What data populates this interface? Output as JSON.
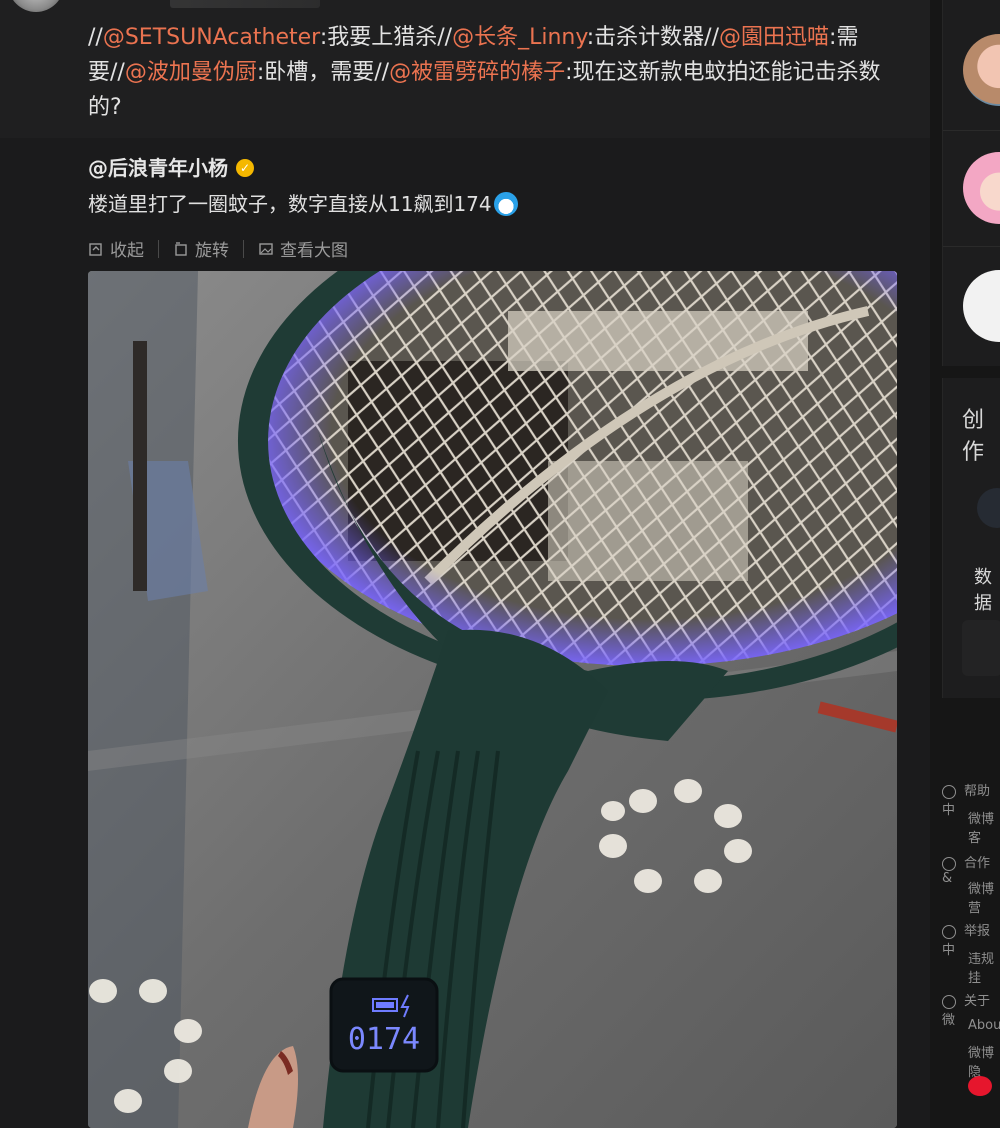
{
  "repost": {
    "segments": [
      {
        "text": "//",
        "type": "plain"
      },
      {
        "text": "@SETSUNAcatheter",
        "type": "mention"
      },
      {
        "text": ":我要上猎杀//",
        "type": "plain"
      },
      {
        "text": "@长条_Linny",
        "type": "mention"
      },
      {
        "text": ":击杀计数器//",
        "type": "plain"
      },
      {
        "text": "@園田迅喵",
        "type": "mention"
      },
      {
        "text": ":需要//",
        "type": "plain"
      },
      {
        "text": "@波加曼伪厨",
        "type": "mention"
      },
      {
        "text": ":卧槽，需要//",
        "type": "plain"
      },
      {
        "text": "@被雷劈碎的榛子",
        "type": "mention"
      },
      {
        "text": ":现在这新款电蚊拍还能记击杀数的?",
        "type": "plain"
      }
    ]
  },
  "original": {
    "author": "@后浪青年小杨",
    "verified_icon": "verified-badge-icon",
    "text": "楼道里打了一圈蚊子，数字直接从11飙到174"
  },
  "actions": {
    "collapse": "收起",
    "rotate": "旋转",
    "view_large": "查看大图"
  },
  "photo": {
    "counter_display": "0174"
  },
  "sidebar": {
    "card_title": "创作",
    "card_item": "数据",
    "footer": [
      {
        "line1": "帮助中",
        "line2": "微博客"
      },
      {
        "line1": "合作&",
        "line2": "微博营"
      },
      {
        "line1": "举报中",
        "line2": "违规挂"
      },
      {
        "line1": "关于微",
        "line2": "About"
      },
      {
        "line1": "",
        "line2": "微博隐"
      }
    ]
  },
  "colors": {
    "mention": "#eb7350",
    "background": "#1b1b1c",
    "verified": "#f5b800"
  }
}
